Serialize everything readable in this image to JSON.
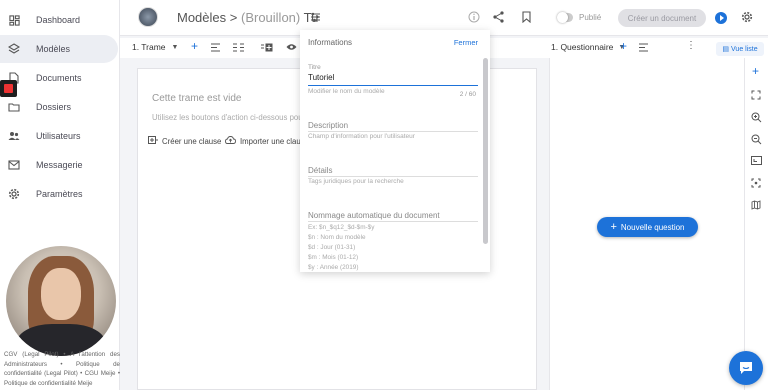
{
  "sidebar": {
    "items": [
      {
        "label": "Dashboard",
        "icon": "dashboard-icon"
      },
      {
        "label": "Modèles",
        "icon": "layers-icon",
        "active": true
      },
      {
        "label": "Documents",
        "icon": "document-icon"
      },
      {
        "label": "Dossiers",
        "icon": "folder-icon"
      },
      {
        "label": "Utilisateurs",
        "icon": "users-icon"
      },
      {
        "label": "Messagerie",
        "icon": "mail-icon"
      },
      {
        "label": "Paramètres",
        "icon": "gear-icon"
      }
    ],
    "footer_text": "CGV (Legal Pilot) • A l'attention des Administrateurs • Politique de confidentialité (Legal Pilot) • CGU Meije • Politique de confidentialité Meije"
  },
  "header": {
    "breadcrumb_section": "Modèles",
    "breadcrumb_separator": ">",
    "breadcrumb_status": "(Brouillon)",
    "breadcrumb_name": "Tu",
    "publish_label": "Publié",
    "create_button": "Créer un document"
  },
  "toolbar": {
    "trame_label": "1. Trame",
    "questionnaire_label": "1. Questionnaire",
    "view_button": "Vue liste"
  },
  "trame": {
    "empty_title": "Cette trame est vide",
    "hint": "Utilisez les boutons d'action ci-dessous pour",
    "create_clause": "Créer une clause",
    "import_clause": "Importer une clause"
  },
  "info_panel": {
    "title": "Informations",
    "close": "Fermer",
    "title_label": "Titre",
    "title_value": "Tutoriel",
    "title_help": "Modifier le nom du modèle",
    "title_counter": "2 / 60",
    "description_label": "Description",
    "description_help": "Champ d'information pour l'utilisateur",
    "details_label": "Détails",
    "details_help": "Tags juridiques pour la recherche",
    "naming_label": "Nommage automatique du document",
    "naming_lines": [
      "Ex: $n_$q12_$d-$m-$y",
      "$n : Nom du modèle",
      "$d : Jour (01-31)",
      "$m : Mois (01-12)",
      "$y : Année (2019)"
    ]
  },
  "questionnaire": {
    "new_question": "Nouvelle question"
  },
  "colors": {
    "accent": "#1d72d9",
    "sidebar_active": "#eceef3",
    "record_red": "#ee3333"
  }
}
